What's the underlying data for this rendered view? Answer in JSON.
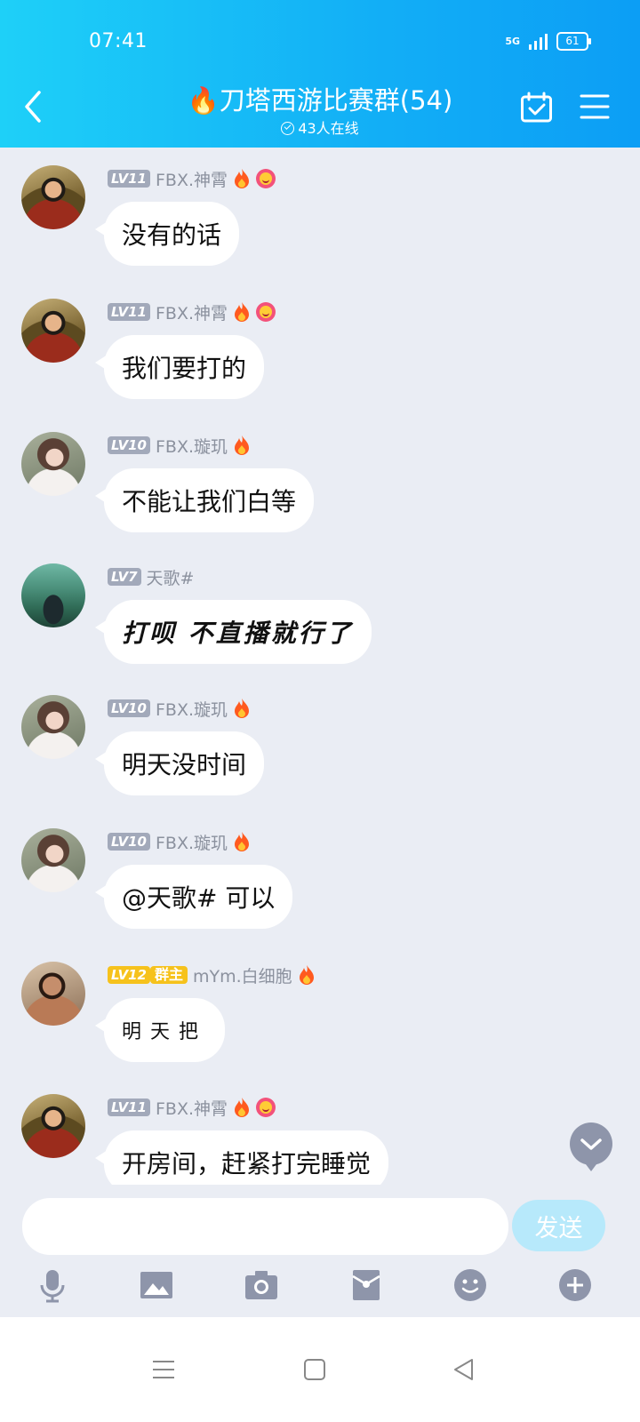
{
  "status": {
    "time": "07:41",
    "network": "5G",
    "battery": "61"
  },
  "header": {
    "title": "🔥刀塔西游比赛群(54)",
    "online": "43人在线"
  },
  "messages": [
    {
      "level": "LV11",
      "nick": "FBX.神霄",
      "text": "没有的话",
      "avatar": "warrior"
    },
    {
      "level": "LV11",
      "nick": "FBX.神霄",
      "text": "我们要打的",
      "avatar": "warrior"
    },
    {
      "level": "LV10",
      "nick": "FBX.璇玑",
      "text": "不能让我们白等",
      "avatar": "girl"
    },
    {
      "level": "LV7",
      "nick": "天歌#",
      "text": "打呗 不直播就行了",
      "avatar": "piano"
    },
    {
      "level": "LV10",
      "nick": "FBX.璇玑",
      "text": "明天没时间",
      "avatar": "girl"
    },
    {
      "level": "LV10",
      "nick": "FBX.璇玑",
      "text": "@天歌# 可以",
      "avatar": "girl"
    },
    {
      "level": "LV12",
      "badge": "群主",
      "nick": "mYm.白细胞",
      "text": "明天把",
      "avatar": "man"
    },
    {
      "level": "LV11",
      "nick": "FBX.神霄",
      "text": "开房间，赶紧打完睡觉",
      "avatar": "warrior"
    }
  ],
  "input": {
    "placeholder": "",
    "send_label": "发送"
  },
  "toolbar": {
    "icons": [
      "mic-icon",
      "image-icon",
      "camera-icon",
      "red-packet-icon",
      "emoji-icon",
      "plus-icon"
    ]
  },
  "colors": {
    "header_start": "#1ed0f8",
    "header_end": "#0c9ef5",
    "chat_bg": "#eaedf4",
    "level_badge": "#a2a9ba",
    "owner_badge": "#f6c21c"
  }
}
